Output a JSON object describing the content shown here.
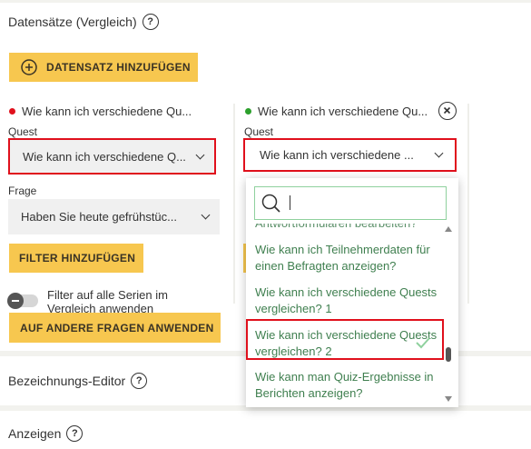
{
  "datasets": {
    "title": "Datensätze (Vergleich)",
    "help_glyph": "?",
    "add_button_label": "DATENSATZ HINZUFÜGEN"
  },
  "series_left": {
    "dot_color": "#e0101c",
    "name": "Wie kann ich verschiedene Qu...",
    "quest_label": "Quest",
    "quest_value": "Wie kann ich verschiedene Q...",
    "frage_label": "Frage",
    "frage_value": "Haben Sie heute gefrühstüc...",
    "filter_button": "FILTER HINZUFÜGEN",
    "toggle_label": "Filter auf alle Serien im Vergleich anwenden",
    "apply_button": "AUF ANDERE FRAGEN ANWENDEN"
  },
  "series_right": {
    "dot_color": "#2ca02c",
    "name": "Wie kann ich verschiedene Qu...",
    "quest_label": "Quest",
    "quest_value": "Wie kann ich verschiedene ...",
    "close_icon": "close-icon"
  },
  "dropdown": {
    "search_value": "",
    "items": [
      "Antwortformularen bearbeiten?",
      "Wie kann ich Teilnehmerdaten für einen Befragten anzeigen?",
      "Wie kann ich verschiedene Quests vergleichen? 1",
      "Wie kann ich verschiedene Quests vergleichen? 2",
      "Wie kann man Quiz-Ergebnisse in Berichten anzeigen?"
    ],
    "selected_item": "Wie kann ich verschiedene Quests vergleichen? 2",
    "check_color": "#8fd19e"
  },
  "label_editor": {
    "title": "Bezeichnungs-Editor",
    "help_glyph": "?"
  },
  "display": {
    "title": "Anzeigen",
    "help_glyph": "?"
  },
  "colors": {
    "accent": "#f7c74f",
    "highlight": "#e0101c",
    "item_text": "#3f7f4f"
  }
}
